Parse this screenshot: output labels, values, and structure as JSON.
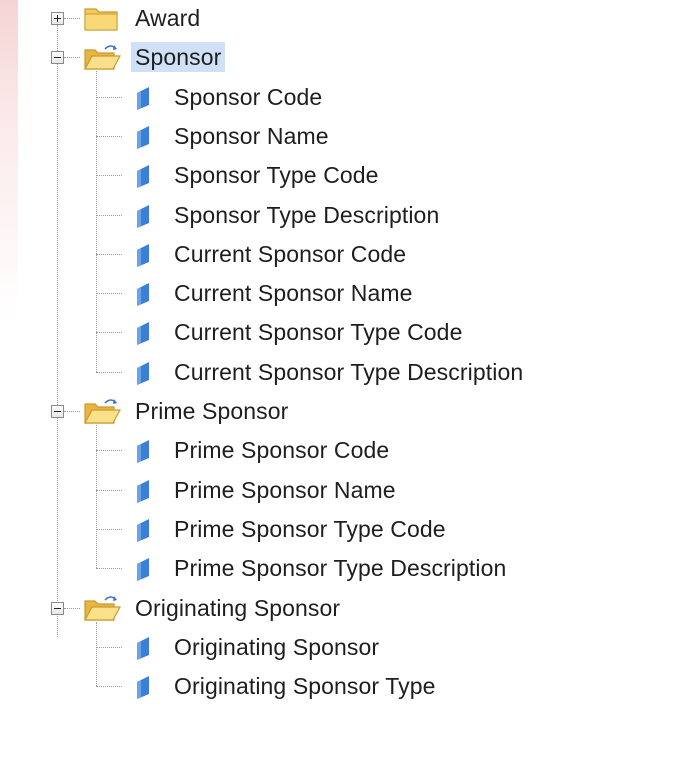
{
  "tree": {
    "nodes": [
      {
        "label": "Award",
        "expanded": false,
        "selected": false,
        "children": []
      },
      {
        "label": "Sponsor",
        "expanded": true,
        "selected": true,
        "children": [
          "Sponsor Code",
          "Sponsor Name",
          "Sponsor Type Code",
          "Sponsor Type Description",
          "Current Sponsor Code",
          "Current Sponsor Name",
          "Current Sponsor Type Code",
          "Current Sponsor Type Description"
        ]
      },
      {
        "label": "Prime Sponsor",
        "expanded": true,
        "selected": false,
        "children": [
          "Prime Sponsor Code",
          "Prime Sponsor Name",
          "Prime Sponsor Type Code",
          "Prime Sponsor Type Description"
        ]
      },
      {
        "label": "Originating Sponsor",
        "expanded": true,
        "selected": false,
        "children": [
          "Originating Sponsor",
          "Originating Sponsor Type"
        ]
      }
    ]
  },
  "colors": {
    "selection": "#cfe0f7",
    "folder_fill": "#f5c95a",
    "folder_edge": "#c89b2c",
    "leaf_icon": "#3b7fd6",
    "text": "#1e1e1e"
  },
  "icons": {
    "collapsed_toggle": "plus-box-icon",
    "expanded_toggle": "minus-box-icon",
    "closed_folder": "folder-closed-icon",
    "open_folder": "folder-open-icon",
    "field": "field-marker-icon"
  }
}
